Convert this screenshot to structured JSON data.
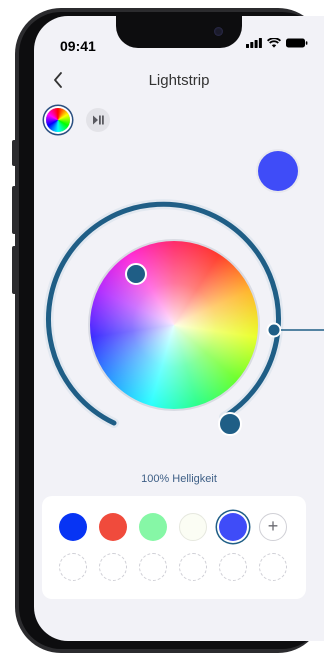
{
  "status_bar": {
    "time": "09:41"
  },
  "header": {
    "title": "Lightstrip",
    "back_label": "‹"
  },
  "selected_color": "#3f4cf8",
  "brightness": {
    "label": "100% Helligkeit",
    "percent": 100
  },
  "swatches": {
    "colors": [
      "#0734f4",
      "#f04b3c",
      "#86f7a6",
      "#fbfdf4",
      "#3f4cf8"
    ],
    "add_label": "+",
    "empty_slots": 6
  },
  "colors": {
    "accent": "#1f5e86",
    "background": "#f2f2f7"
  }
}
